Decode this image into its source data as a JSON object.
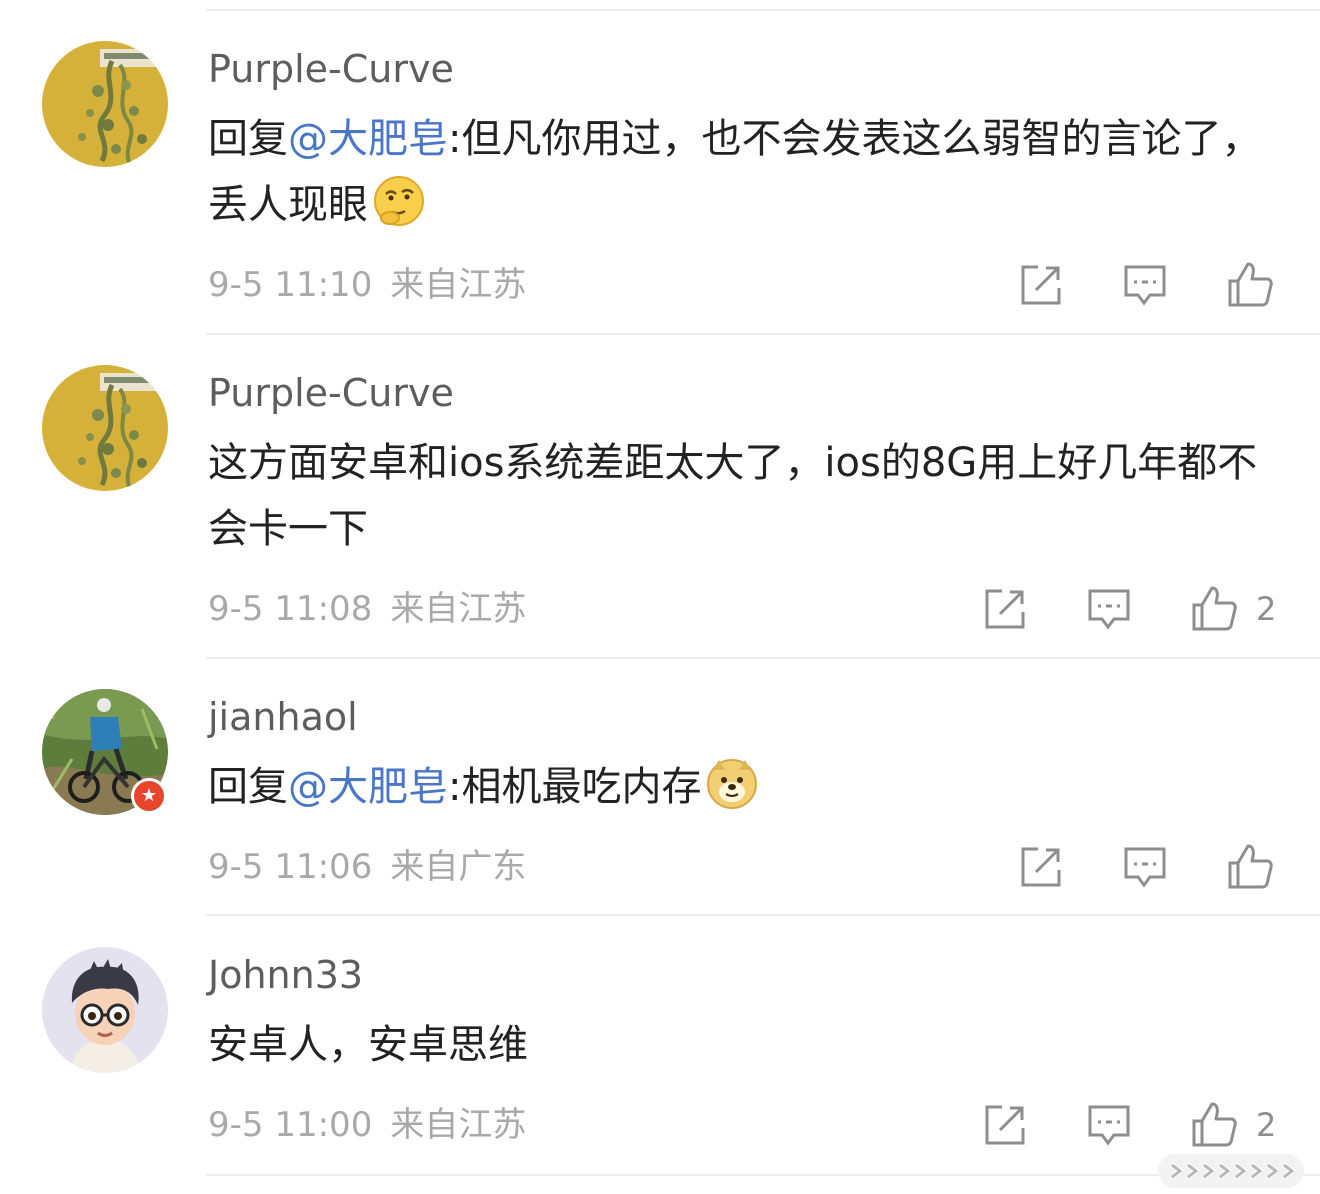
{
  "comments": [
    {
      "username": "Purple-Curve",
      "reply_prefix": "回复",
      "mention": "@大肥皂",
      "text": ":但凡你用过，也不会发表这么弱智的言论了，丢人现眼",
      "emoji": "thinking-face-emoji",
      "date": "9-5 11:10",
      "location": "来自江苏",
      "like_count": ""
    },
    {
      "username": "Purple-Curve",
      "text": "这方面安卓和ios系统差距太大了，ios的8G用上好几年都不会卡一下",
      "date": "9-5 11:08",
      "location": "来自江苏",
      "like_count": "2"
    },
    {
      "username": "jianhaol",
      "reply_prefix": "回复",
      "mention": "@大肥皂",
      "text": ":相机最吃内存",
      "emoji": "doge-emoji",
      "date": "9-5 11:06",
      "location": "来自广东",
      "like_count": ""
    },
    {
      "username": "Johnn33",
      "text": "安卓人，安卓思维",
      "date": "9-5 11:00",
      "location": "来自江苏",
      "like_count": "2"
    }
  ],
  "colors": {
    "mention": "#4a76c7",
    "text": "#222222",
    "username": "#5d5d5d",
    "meta": "#a9a9a9",
    "icon": "#8e8e8e",
    "verified_badge": "#e8452c"
  },
  "icons": [
    "share-icon",
    "comment-icon",
    "like-icon",
    "more-icon"
  ]
}
